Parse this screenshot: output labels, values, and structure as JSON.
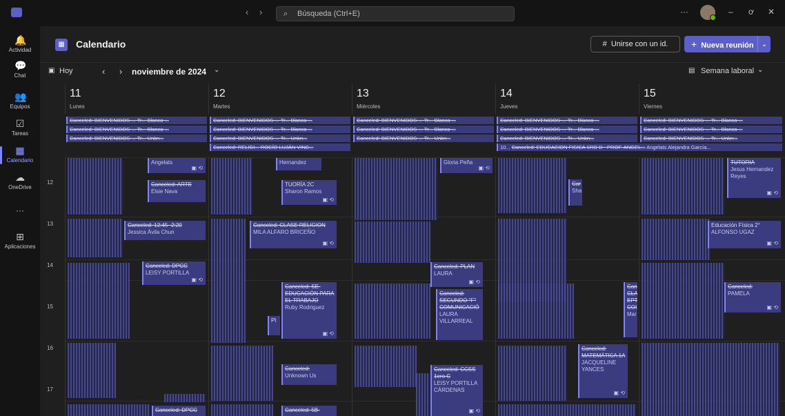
{
  "titlebar": {
    "search_placeholder": "Búsqueda (Ctrl+E)",
    "more": "···",
    "minimize": "–",
    "restore": "ơ",
    "close": "✕"
  },
  "rail": [
    {
      "label": "Actividad",
      "icon": "bell-icon",
      "glyph": "🔔"
    },
    {
      "label": "Chat",
      "icon": "chat-icon",
      "glyph": "💬"
    },
    {
      "label": "Equipos",
      "icon": "teams-icon",
      "glyph": "👥"
    },
    {
      "label": "Tareas",
      "icon": "tasks-icon",
      "glyph": "☑"
    },
    {
      "label": "Calendario",
      "icon": "calendar-icon",
      "glyph": "▦"
    },
    {
      "label": "OneDrive",
      "icon": "cloud-icon",
      "glyph": "☁"
    },
    {
      "label": "···",
      "icon": "more-icon",
      "glyph": ""
    },
    {
      "label": "Aplicaciones",
      "icon": "apps-icon",
      "glyph": "⊞"
    }
  ],
  "header": {
    "title": "Calendario",
    "join_label": "Unirse con un id.",
    "join_icon": "#",
    "new_meeting_label": "Nueva reunión"
  },
  "toolbar": {
    "today": "Hoy",
    "month": "noviembre de 2024",
    "view": "Semana laboral"
  },
  "days": [
    {
      "num": "11",
      "name": "Lunes"
    },
    {
      "num": "12",
      "name": "Martes"
    },
    {
      "num": "13",
      "name": "Miércoles"
    },
    {
      "num": "14",
      "name": "Jueves"
    },
    {
      "num": "15",
      "name": "Viernes"
    }
  ],
  "allday": {
    "row_bienvenidos_a": "Canceled: BIENVENIDOS-...  Tr...  Blanca ...",
    "row_bienvenidos_b": "Canceled: BIENVENIDOS-...  Tr...  Blanca ...",
    "row_bienvenidos_c": "Canceled: BIENVENIDOS-...  Tr...  Unkn...",
    "religion": "Canceled: RELIGI...   ROCÍO LUJÁN VINC...",
    "edufisica_prefix": "10...",
    "edufisica": "Canceled: EDUCACION FISICA 1RO D - PROF. ANGEL...",
    "edufisica_org": "Angelats Alejandra García..."
  },
  "hours": [
    "12",
    "13",
    "14",
    "15",
    "16",
    "17"
  ],
  "events": {
    "mon_angelats": {
      "org": "Angelats"
    },
    "mon_arte": {
      "title": "Canceled: ARTE",
      "org": "Elsie Nava"
    },
    "mon_1245": {
      "title": "Canceled: 12:45 -2:20",
      "org": "Jessica Ávila Chun"
    },
    "mon_dpcc1": {
      "title": "Canceled: DPCC",
      "org": "LEISY PORTILLA"
    },
    "mon_dpcc2": {
      "title": "Canceled: DPCC"
    },
    "tue_hernandez": {
      "org": "Hernandez"
    },
    "tue_tutoria": {
      "title": "TUORÍA 2C",
      "org": "Sharon Ramos"
    },
    "tue_religion": {
      "title": "Canceled: CLASE RELIGION",
      "org": "MILA ALFARO BRICEÑO"
    },
    "tue_se": {
      "title": "Canceled: SE- EDUCACIÓN PARA EL TRABAJO",
      "org": "Ruby Rodriguez"
    },
    "tue_pl": {
      "title": "Pl"
    },
    "tue_unknown": {
      "title": "Canceled:",
      "org": "Unknown Us"
    },
    "tue_5b": {
      "title": "Canceled: 5B-"
    },
    "wed_gloria": {
      "org": "Gloria Peña"
    },
    "wed_plan": {
      "title": "Canceled: PLAN",
      "org": "LAURA"
    },
    "wed_segundo": {
      "title": "Canceled: SEGUNDO \"F\" COMUNICACIÓ",
      "org": "LAURA VILLARREAL"
    },
    "wed_ccss": {
      "title": "Canceled: CCSS 1ero C",
      "org": "LEISY PORTILLA CÁRDENAS"
    },
    "thu_car": {
      "title": "Car",
      "org": "Sha"
    },
    "thu_cla": {
      "title": "Can CLA EPT COI",
      "org": "Mar"
    },
    "thu_matematica": {
      "title": "Canceled: MATEMÁTICA 1A",
      "org": "JACQUELINE YANCES"
    },
    "fri_tutoria": {
      "title": "TUTORIA",
      "org": "Jesus Hernandez Reyes"
    },
    "fri_edufisica": {
      "title": "Educación Física 2°",
      "org": "ALFONSO UGAZ"
    },
    "fri_pamela": {
      "title": "Canceled:",
      "org": "PAMELA"
    }
  },
  "colors": {
    "accent": "#5b5fc7",
    "event_bg": "#3b3c80",
    "event_border": "#7f85f5",
    "app_bg": "#1f1f1f"
  }
}
